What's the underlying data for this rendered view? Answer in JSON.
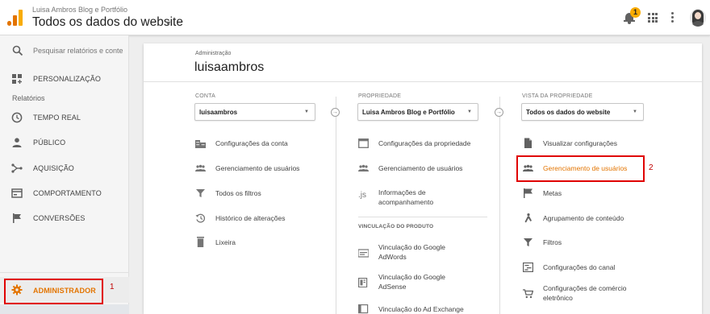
{
  "header": {
    "account_small": "Luisa Ambros Blog e Portfólio",
    "view_selector": "Todos os dados do website",
    "notification_count": "1"
  },
  "sidebar": {
    "search_placeholder": "Pesquisar relatórios e conte",
    "customization": "PERSONALIZAÇÃO",
    "section_reports": "Relatórios",
    "items": [
      {
        "label": "TEMPO REAL",
        "icon": "clock-icon"
      },
      {
        "label": "PÚBLICO",
        "icon": "person-icon"
      },
      {
        "label": "AQUISIÇÃO",
        "icon": "acquisition-icon"
      },
      {
        "label": "COMPORTAMENTO",
        "icon": "behavior-icon"
      },
      {
        "label": "CONVERSÕES",
        "icon": "flag-icon"
      }
    ],
    "admin": "ADMINISTRADOR",
    "admin_annotation": "1"
  },
  "main": {
    "breadcrumb": "Administração",
    "title": "luisaambros",
    "account_column": {
      "heading": "CONTA",
      "selected": "luisaambros",
      "items": [
        {
          "label": "Configurações da conta",
          "icon": "building-icon"
        },
        {
          "label": "Gerenciamento de usuários",
          "icon": "users-icon"
        },
        {
          "label": "Todos os filtros",
          "icon": "filter-icon"
        },
        {
          "label": "Histórico de alterações",
          "icon": "history-icon"
        },
        {
          "label": "Lixeira",
          "icon": "trash-icon"
        }
      ]
    },
    "property_column": {
      "heading": "PROPRIEDADE",
      "selected": "Luisa Ambros Blog e Portfólio",
      "items": [
        {
          "label": "Configurações da propriedade",
          "icon": "window-icon"
        },
        {
          "label": "Gerenciamento de usuários",
          "icon": "users-icon"
        },
        {
          "label": "Informações de acompanhamento",
          "icon": "js-icon",
          "icon_text": ".js"
        }
      ],
      "product_linking_heading": "VINCULAÇÃO DO PRODUTO",
      "product_items": [
        {
          "label": "Vinculação do Google AdWords",
          "icon": "adwords-icon"
        },
        {
          "label": "Vinculação do Google AdSense",
          "icon": "adsense-icon"
        },
        {
          "label": "Vinculação do Ad Exchange",
          "icon": "adexchange-icon"
        }
      ]
    },
    "view_column": {
      "heading": "VISTA DA PROPRIEDADE",
      "selected": "Todos os dados do website",
      "items": [
        {
          "label": "Visualizar configurações",
          "icon": "document-icon"
        },
        {
          "label": "Gerenciamento de usuários",
          "icon": "users-icon",
          "highlighted": true
        },
        {
          "label": "Metas",
          "icon": "flag-icon"
        },
        {
          "label": "Agrupamento de conteúdo",
          "icon": "walker-icon"
        },
        {
          "label": "Filtros",
          "icon": "filter-icon"
        },
        {
          "label": "Configurações do canal",
          "icon": "channel-icon"
        },
        {
          "label": "Configurações de comércio eletrônico",
          "icon": "cart-icon"
        }
      ],
      "highlight_annotation": "2"
    }
  },
  "colors": {
    "accent": "#e37400",
    "annotation": "#e00000"
  }
}
